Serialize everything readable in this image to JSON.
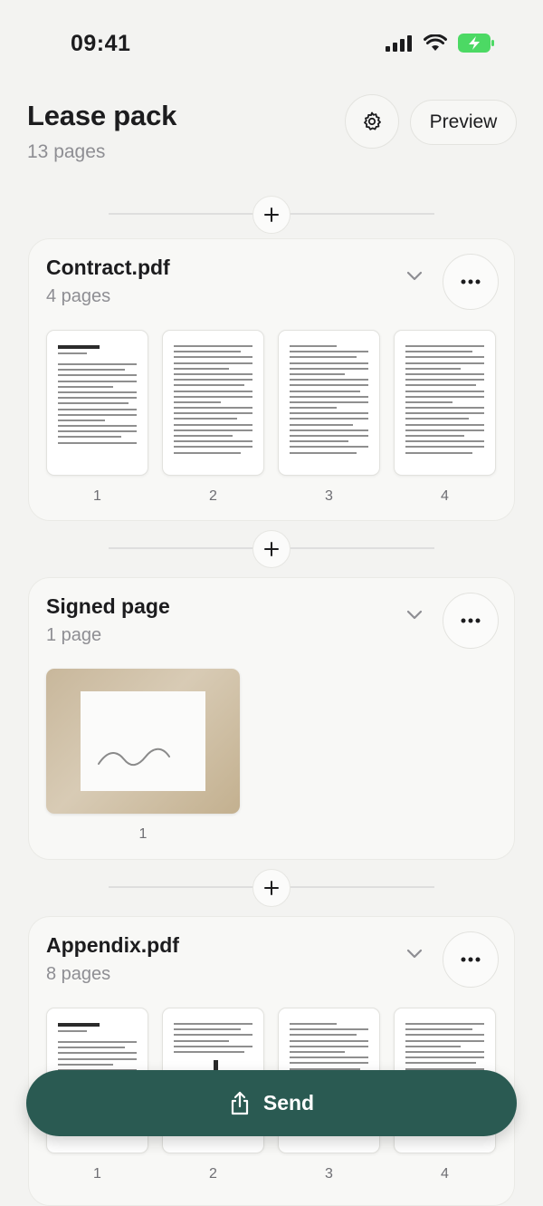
{
  "status_bar": {
    "time": "09:41"
  },
  "header": {
    "title": "Lease pack",
    "subtitle": "13 pages",
    "preview_label": "Preview"
  },
  "documents": [
    {
      "title": "Contract.pdf",
      "subtitle": "4 pages",
      "pages": [
        "1",
        "2",
        "3",
        "4"
      ]
    },
    {
      "title": "Signed page",
      "subtitle": "1 page",
      "pages": [
        "1"
      ]
    },
    {
      "title": "Appendix.pdf",
      "subtitle": "8 pages",
      "pages": [
        "1",
        "2",
        "3",
        "4"
      ]
    }
  ],
  "send_label": "Send",
  "colors": {
    "accent": "#2a5a52",
    "battery": "#4cd964"
  },
  "icons": [
    "signal-icon",
    "wifi-icon",
    "battery-icon",
    "gear-icon",
    "plus-icon",
    "chevron-down-icon",
    "more-icon",
    "share-icon"
  ]
}
